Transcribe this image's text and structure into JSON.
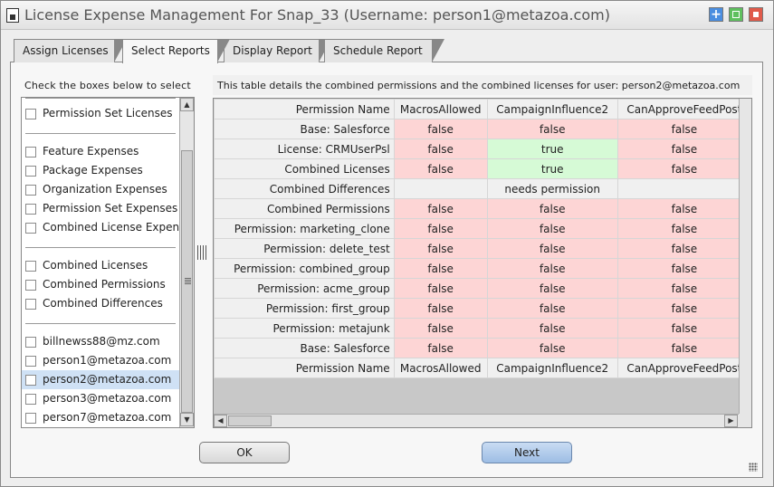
{
  "window": {
    "title": "License Expense Management For Snap_33 (Username: person1@metazoa.com)"
  },
  "tabs": [
    {
      "label": "Assign Licenses",
      "active": false
    },
    {
      "label": "Select Reports",
      "active": true
    },
    {
      "label": "Display Report",
      "active": false
    },
    {
      "label": "Schedule Report",
      "active": false
    }
  ],
  "left_panel": {
    "header": "Check the boxes below to select",
    "items": [
      {
        "label": "Permission Set Licenses",
        "checked": false
      },
      {
        "label": "Feature Expenses",
        "checked": false
      },
      {
        "label": "Package Expenses",
        "checked": false
      },
      {
        "label": "Organization Expenses",
        "checked": false
      },
      {
        "label": "Permission Set Expenses",
        "checked": false
      },
      {
        "label": "Combined License Expenses",
        "checked": false
      },
      {
        "label": "Combined Licenses",
        "checked": false
      },
      {
        "label": "Combined Permissions",
        "checked": false
      },
      {
        "label": "Combined Differences",
        "checked": false
      },
      {
        "label": "billnewss88@mz.com",
        "checked": false
      },
      {
        "label": "person1@metazoa.com",
        "checked": false
      },
      {
        "label": "person2@metazoa.com",
        "checked": false,
        "selected": true
      },
      {
        "label": "person3@metazoa.com",
        "checked": false
      },
      {
        "label": "person7@metazoa.com",
        "checked": false
      }
    ]
  },
  "right_panel": {
    "header": "This table details the combined permissions and the combined licenses for user: person2@metazoa.com",
    "columns": [
      "Permission Name",
      "MacrosAllowed",
      "CampaignInfluence2",
      "CanApproveFeedPost"
    ],
    "rows": [
      {
        "name": "Base: Salesforce",
        "cells": [
          "false",
          "false",
          "false"
        ]
      },
      {
        "name": "License: CRMUserPsl",
        "cells": [
          "false",
          "true",
          "false"
        ]
      },
      {
        "name": "Combined Licenses",
        "cells": [
          "false",
          "true",
          "false"
        ]
      },
      {
        "name": "Combined Differences",
        "cells": [
          "",
          "needs permission",
          ""
        ]
      },
      {
        "name": "Combined Permissions",
        "cells": [
          "false",
          "false",
          "false"
        ]
      },
      {
        "name": "Permission: marketing_clone",
        "cells": [
          "false",
          "false",
          "false"
        ]
      },
      {
        "name": "Permission: delete_test",
        "cells": [
          "false",
          "false",
          "false"
        ]
      },
      {
        "name": "Permission: combined_group",
        "cells": [
          "false",
          "false",
          "false"
        ]
      },
      {
        "name": "Permission: acme_group",
        "cells": [
          "false",
          "false",
          "false"
        ]
      },
      {
        "name": "Permission: first_group",
        "cells": [
          "false",
          "false",
          "false"
        ]
      },
      {
        "name": "Permission: metajunk",
        "cells": [
          "false",
          "false",
          "false"
        ]
      },
      {
        "name": "Base: Salesforce",
        "cells": [
          "false",
          "false",
          "false"
        ]
      }
    ],
    "footer_columns": [
      "Permission Name",
      "MacrosAllowed",
      "CampaignInfluence2",
      "CanApproveFeedPost"
    ],
    "colors": {
      "false": "#fdd5d5",
      "true": "#d6fad6"
    }
  },
  "buttons": {
    "ok": "OK",
    "next": "Next"
  }
}
